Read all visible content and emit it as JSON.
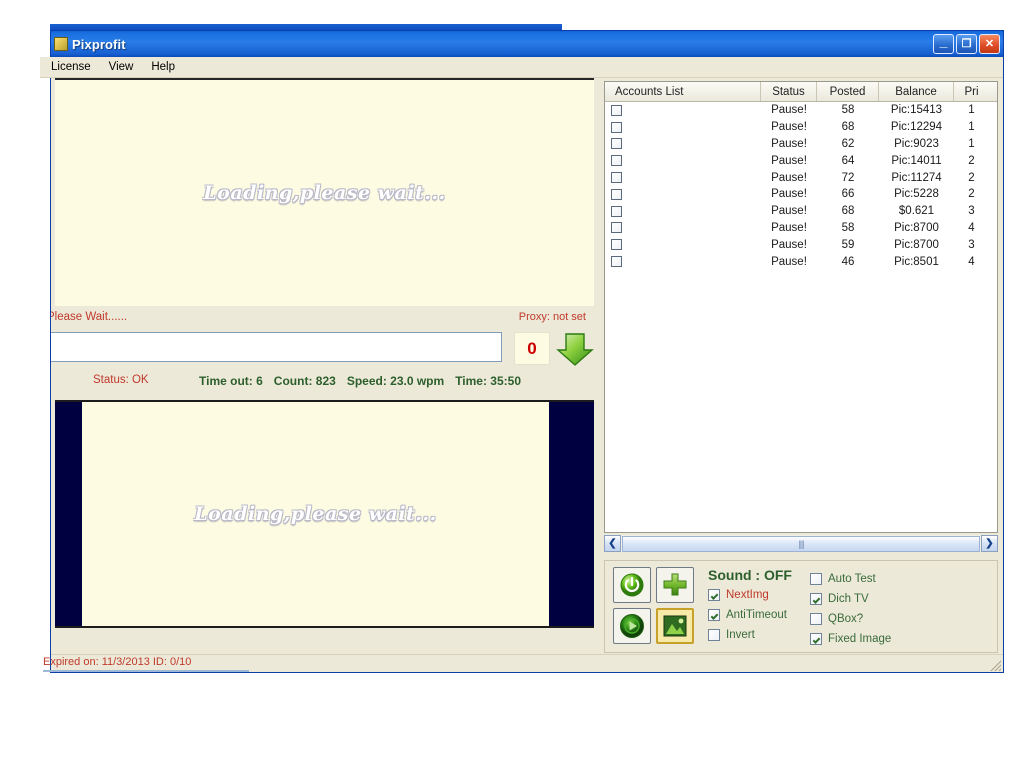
{
  "window": {
    "title": "Pixprofit",
    "icon": "app-icon",
    "buttons": {
      "minimize": "_",
      "maximize": "❐",
      "close": "✕"
    }
  },
  "menu": {
    "items": [
      "License",
      "View",
      "Help"
    ]
  },
  "captcha_top": {
    "loading_text": "Loading,please wait..."
  },
  "captcha_bottom": {
    "loading_text": "Loading,please wait..."
  },
  "status_row": {
    "please_wait": "Please Wait......",
    "proxy": "Proxy: not set"
  },
  "answer": {
    "value": "",
    "placeholder": "",
    "counter": "0",
    "arrow_icon": "down-arrow-icon"
  },
  "stats": {
    "status": "Status: OK",
    "timeout": "Time out: 6",
    "count": "Count: 823",
    "speed": "Speed: 23.0 wpm",
    "time": "Time: 35:50"
  },
  "accounts": {
    "columns": [
      "Accounts List",
      "Status",
      "Posted",
      "Balance",
      "Pri"
    ],
    "rows": [
      {
        "name": "",
        "status": "Pause!",
        "posted": "58",
        "balance": "Pic:15413",
        "pri": "1"
      },
      {
        "name": "",
        "status": "Pause!",
        "posted": "68",
        "balance": "Pic:12294",
        "pri": "1"
      },
      {
        "name": "",
        "status": "Pause!",
        "posted": "62",
        "balance": "Pic:9023",
        "pri": "1"
      },
      {
        "name": "",
        "status": "Pause!",
        "posted": "64",
        "balance": "Pic:14011",
        "pri": "2"
      },
      {
        "name": "",
        "status": "Pause!",
        "posted": "72",
        "balance": "Pic:11274",
        "pri": "2"
      },
      {
        "name": "",
        "status": "Pause!",
        "posted": "66",
        "balance": "Pic:5228",
        "pri": "2"
      },
      {
        "name": "",
        "status": "Pause!",
        "posted": "68",
        "balance": "$0.621",
        "pri": "3"
      },
      {
        "name": "",
        "status": "Pause!",
        "posted": "58",
        "balance": "Pic:8700",
        "pri": "4"
      },
      {
        "name": "",
        "status": "Pause!",
        "posted": "59",
        "balance": "Pic:8700",
        "pri": "3"
      },
      {
        "name": "",
        "status": "Pause!",
        "posted": "46",
        "balance": "Pic:8501",
        "pri": "4"
      }
    ]
  },
  "scrollbar": {
    "left_arrow": "❮",
    "right_arrow": "❯",
    "grip": "||||"
  },
  "controls": {
    "buttons": [
      "power-button",
      "add-button",
      "play-button",
      "image-button"
    ],
    "sound_label": "Sound : OFF",
    "checkboxes_left": [
      {
        "label": "NextImg",
        "checked": true,
        "red": true
      },
      {
        "label": "AntiTimeout",
        "checked": true,
        "red": false
      },
      {
        "label": "Invert",
        "checked": false,
        "red": false
      }
    ],
    "checkboxes_right": [
      {
        "label": "Auto Test",
        "checked": false
      },
      {
        "label": "Dich TV",
        "checked": true
      },
      {
        "label": "QBox?",
        "checked": false
      },
      {
        "label": "Fixed Image",
        "checked": true
      }
    ]
  },
  "statusbar": {
    "expiry": "Expired on: 11/3/2013  ID: 0/10"
  },
  "colors": {
    "titlebar_blue": "#1a6fe0",
    "panel_cream": "#fdfbe2",
    "navy": "#000040",
    "accent_green": "#2d5f2d",
    "accent_red": "#c0392b",
    "chrome": "#ece9d8"
  }
}
